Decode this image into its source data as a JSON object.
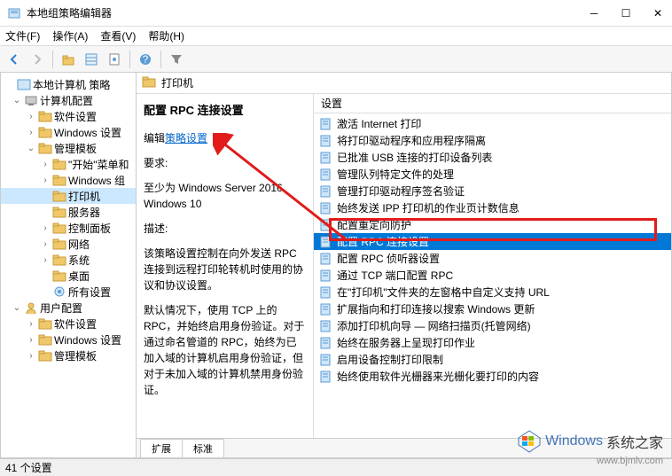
{
  "window": {
    "title": "本地组策略编辑器"
  },
  "menubar": {
    "file": "文件(F)",
    "action": "操作(A)",
    "view": "查看(V)",
    "help": "帮助(H)"
  },
  "tree": {
    "root": "本地计算机 策略",
    "computer_config": "计算机配置",
    "software_settings": "软件设置",
    "windows_settings": "Windows 设置",
    "admin_templates": "管理模板",
    "start_menu": "\"开始\"菜单和",
    "windows_components": "Windows 组",
    "printers": "打印机",
    "servers": "服务器",
    "control_panel": "控制面板",
    "network": "网络",
    "system": "系统",
    "desktop": "桌面",
    "all_settings": "所有设置",
    "user_config": "用户配置",
    "u_software": "软件设置",
    "u_windows": "Windows 设置",
    "u_admin": "管理模板"
  },
  "path": {
    "current": "打印机"
  },
  "detail": {
    "title": "配置 RPC 连接设置",
    "edit_prefix": "编辑",
    "edit_link": "策略设置",
    "req_label": "要求:",
    "req_text": "至少为 Windows Server 2016、Windows 10",
    "desc_label": "描述:",
    "desc_text": "该策略设置控制在向外发送 RPC 连接到远程打印轮转机时使用的协议和协议设置。",
    "desc_text2": "默认情况下，使用 TCP 上的 RPC，并始终启用身份验证。对于通过命名管道的 RPC，始终为已加入域的计算机启用身份验证，但对于未加入域的计算机禁用身份验证。"
  },
  "list": {
    "header": "设置",
    "items": [
      "激活 Internet 打印",
      "将打印驱动程序和应用程序隔离",
      "已批准 USB 连接的打印设备列表",
      "管理队列特定文件的处理",
      "管理打印驱动程序签名验证",
      "始终发送 IPP 打印机的作业页计数信息",
      "配置重定向防护",
      "配置 RPC 连接设置",
      "配置 RPC 侦听器设置",
      "通过 TCP 端口配置 RPC",
      "在\"打印机\"文件夹的左窗格中自定义支持 URL",
      "扩展指向和打印连接以搜索 Windows 更新",
      "添加打印机向导 — 网络扫描页(托管网络)",
      "始终在服务器上呈现打印作业",
      "启用设备控制打印限制",
      "始终使用软件光栅器来光栅化要打印的内容"
    ],
    "selected_index": 7
  },
  "tabs": {
    "extended": "扩展",
    "standard": "标准"
  },
  "status": {
    "text": "41 个设置"
  },
  "watermark": {
    "brand1": "Windows",
    "brand2": "系统之家",
    "url": "www.bjmlv.com"
  }
}
